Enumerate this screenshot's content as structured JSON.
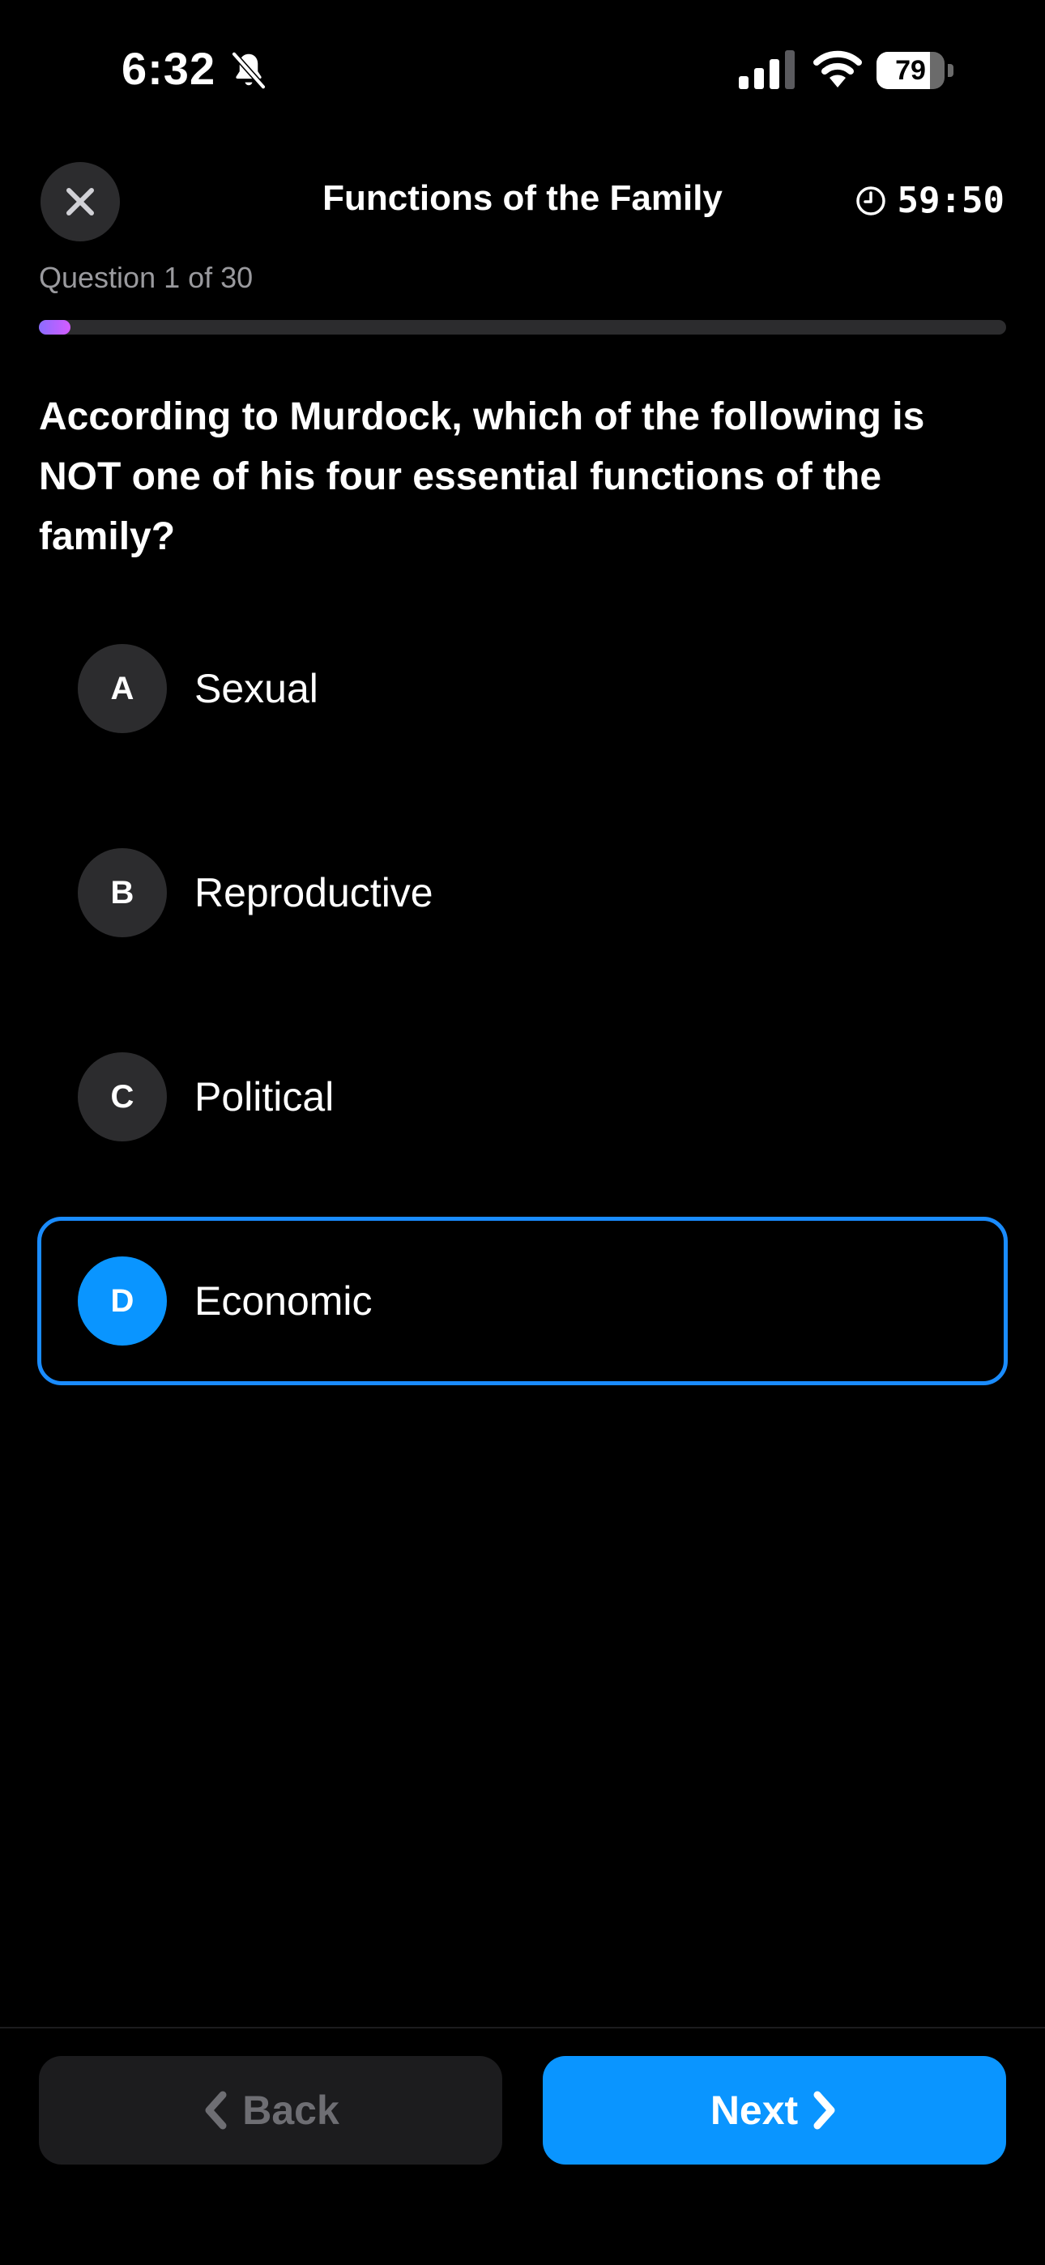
{
  "status_bar": {
    "time": "6:32",
    "battery": "79",
    "battery_level": 0.79
  },
  "header": {
    "title": "Functions of the Family",
    "timer": "59:50"
  },
  "progress": {
    "counter": "Question 1 of 30",
    "fraction": 0.033
  },
  "question": {
    "text": "According to Murdock, which of the following is NOT one of his four essential functions of the family?"
  },
  "options": [
    {
      "letter": "A",
      "label": "Sexual",
      "selected": false
    },
    {
      "letter": "B",
      "label": "Reproductive",
      "selected": false
    },
    {
      "letter": "C",
      "label": "Political",
      "selected": false
    },
    {
      "letter": "D",
      "label": "Economic",
      "selected": true
    }
  ],
  "footer": {
    "back_label": "Back",
    "next_label": "Next"
  },
  "colors": {
    "accent": "#0a95ff",
    "progress_start": "#8b6cff",
    "progress_end": "#d45cff",
    "surface": "#2c2c2e"
  },
  "icons": {
    "close": "close-icon",
    "timer": "clock-icon",
    "back": "chevron-left-icon",
    "next": "chevron-right-icon",
    "muted": "bell-slash-icon"
  }
}
